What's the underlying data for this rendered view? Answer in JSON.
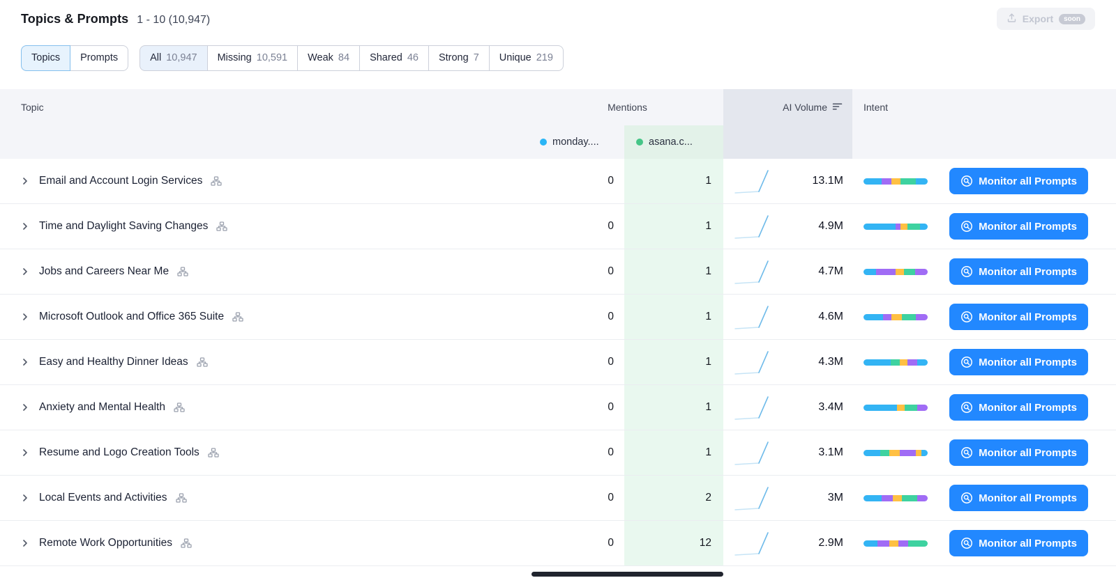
{
  "header": {
    "title": "Topics & Prompts",
    "range": "1 - 10 (10,947)",
    "export": {
      "label": "Export",
      "badge": "soon"
    }
  },
  "filters": {
    "view": [
      {
        "label": "Topics"
      },
      {
        "label": "Prompts"
      }
    ],
    "segments": [
      {
        "label": "All",
        "count": "10,947"
      },
      {
        "label": "Missing",
        "count": "10,591"
      },
      {
        "label": "Weak",
        "count": "84"
      },
      {
        "label": "Shared",
        "count": "46"
      },
      {
        "label": "Strong",
        "count": "7"
      },
      {
        "label": "Unique",
        "count": "219"
      }
    ]
  },
  "table": {
    "headers": {
      "topic": "Topic",
      "mentions": "Mentions",
      "ai_volume": "AI Volume",
      "intent": "Intent"
    },
    "domains": [
      {
        "label": "monday....",
        "color": "#2ab5f6"
      },
      {
        "label": "asana.c...",
        "color": "#45c587"
      }
    ],
    "monitor_label": "Monitor all Prompts",
    "intent_colors": {
      "blue": "#33b4f4",
      "purple": "#a06cf5",
      "yellow": "#ffc043",
      "green": "#3ed2a0"
    },
    "rows": [
      {
        "topic": "Email and Account Login Services",
        "monday": "0",
        "asana": "1",
        "ai_volume": "13.1M",
        "intent": [
          [
            "blue",
            28
          ],
          [
            "purple",
            15
          ],
          [
            "yellow",
            15
          ],
          [
            "green",
            24
          ],
          [
            "blue",
            18
          ]
        ]
      },
      {
        "topic": "Time and Daylight Saving Changes",
        "monday": "0",
        "asana": "1",
        "ai_volume": "4.9M",
        "intent": [
          [
            "blue",
            50
          ],
          [
            "purple",
            8
          ],
          [
            "yellow",
            10
          ],
          [
            "green",
            20
          ],
          [
            "blue",
            12
          ]
        ]
      },
      {
        "topic": "Jobs and Careers Near Me",
        "monday": "0",
        "asana": "1",
        "ai_volume": "4.7M",
        "intent": [
          [
            "blue",
            20
          ],
          [
            "purple",
            30
          ],
          [
            "yellow",
            13
          ],
          [
            "green",
            17
          ],
          [
            "purple",
            20
          ]
        ]
      },
      {
        "topic": "Microsoft Outlook and Office 365 Suite",
        "monday": "0",
        "asana": "1",
        "ai_volume": "4.6M",
        "intent": [
          [
            "blue",
            30
          ],
          [
            "purple",
            14
          ],
          [
            "yellow",
            16
          ],
          [
            "green",
            22
          ],
          [
            "purple",
            18
          ]
        ]
      },
      {
        "topic": "Easy and Healthy Dinner Ideas",
        "monday": "0",
        "asana": "1",
        "ai_volume": "4.3M",
        "intent": [
          [
            "blue",
            42
          ],
          [
            "green",
            14
          ],
          [
            "yellow",
            12
          ],
          [
            "purple",
            16
          ],
          [
            "blue",
            16
          ]
        ]
      },
      {
        "topic": "Anxiety and Mental Health",
        "monday": "0",
        "asana": "1",
        "ai_volume": "3.4M",
        "intent": [
          [
            "blue",
            52
          ],
          [
            "yellow",
            12
          ],
          [
            "green",
            20
          ],
          [
            "purple",
            16
          ]
        ]
      },
      {
        "topic": "Resume and Logo Creation Tools",
        "monday": "0",
        "asana": "1",
        "ai_volume": "3.1M",
        "intent": [
          [
            "blue",
            26
          ],
          [
            "green",
            14
          ],
          [
            "yellow",
            16
          ],
          [
            "purple",
            26
          ],
          [
            "yellow",
            8
          ],
          [
            "blue",
            10
          ]
        ]
      },
      {
        "topic": "Local Events and Activities",
        "monday": "0",
        "asana": "2",
        "ai_volume": "3M",
        "intent": [
          [
            "blue",
            28
          ],
          [
            "purple",
            18
          ],
          [
            "yellow",
            14
          ],
          [
            "green",
            24
          ],
          [
            "purple",
            16
          ]
        ]
      },
      {
        "topic": "Remote Work Opportunities",
        "monday": "0",
        "asana": "12",
        "ai_volume": "2.9M",
        "intent": [
          [
            "blue",
            22
          ],
          [
            "purple",
            18
          ],
          [
            "yellow",
            14
          ],
          [
            "purple",
            16
          ],
          [
            "green",
            30
          ]
        ]
      }
    ]
  }
}
